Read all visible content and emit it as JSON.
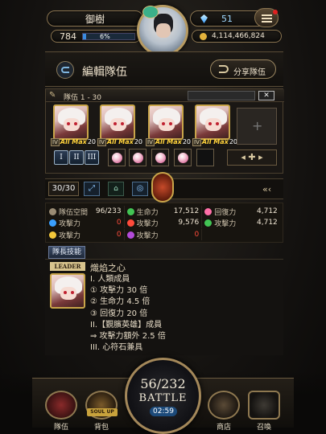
{
  "top": {
    "username": "御樹",
    "level": "784",
    "exp_percent": "6%",
    "exp_fraction": 0.06,
    "gems": "51",
    "coins": "4,114,466,824"
  },
  "header": {
    "title": "編輯隊伍",
    "share_label": "分享隊伍"
  },
  "team": {
    "tab_label": "隊伍 1 - 30",
    "slots": [
      {
        "lv": "IV",
        "status": "All Max",
        "num": "20"
      },
      {
        "lv": "IV",
        "status": "All Max",
        "num": "20"
      },
      {
        "lv": "IV",
        "status": "All Max",
        "num": "20"
      },
      {
        "lv": "IV",
        "status": "All Max",
        "num": "20"
      }
    ],
    "add_symbol": "+",
    "roman_buttons": [
      "I",
      "II",
      "III"
    ],
    "count": "30/30"
  },
  "stats": {
    "space_label": "隊伍空間",
    "space_value": "96/233",
    "hp_label": "生命力",
    "hp_value": "17,512",
    "rec_label": "回復力",
    "rec_value": "4,712",
    "atk_label": "攻擊力",
    "atk_values": [
      "0",
      "9,576",
      "4,712",
      "0",
      "0",
      "0"
    ]
  },
  "leader": {
    "skill_tab": "隊長技能",
    "badge": "LEADER",
    "skill_name": "熾焰之心",
    "desc": [
      "I. 人類成員",
      "① 攻擊力 30 倍",
      "② 生命力 4.5 倍",
      "③ 回復力 20 倍",
      "II.【覲臏英雄】成員",
      "⇒ 攻擊力額外 2.5 倍",
      "III. 心符石兼具"
    ]
  },
  "nav": {
    "team": "隊伍",
    "bag": "背包",
    "soul_up": "SOUL UP",
    "stamina": "56/232",
    "battle": "BATTLE",
    "timer": "02:59",
    "shop": "商店",
    "summon": "召喚"
  },
  "colors": {
    "accent_gold": "#c9a54a",
    "water": "#3aa0ff",
    "fire": "#ff4b3b",
    "wood": "#42c454",
    "light": "#f3c73a",
    "dark": "#b24bd9",
    "heart": "#ff6fa8"
  }
}
